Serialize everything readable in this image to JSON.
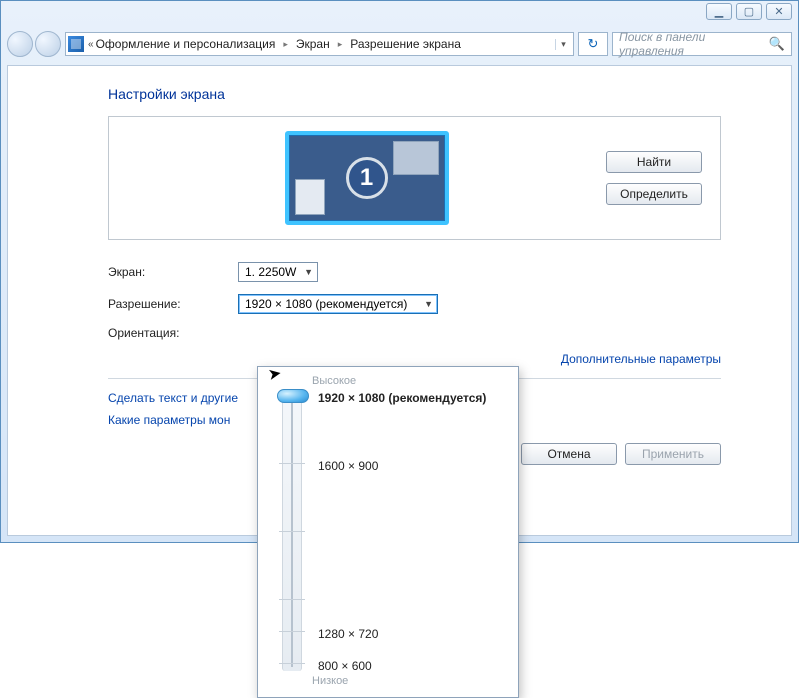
{
  "window": {
    "minimize_symbol": "▁",
    "maximize_symbol": "▢",
    "close_symbol": "✕"
  },
  "address": {
    "chevron_back": "«",
    "crumb1": "Оформление и персонализация",
    "crumb2": "Экран",
    "crumb3": "Разрешение экрана",
    "dropdown_symbol": "▾",
    "refresh_symbol": "↻"
  },
  "search": {
    "placeholder": "Поиск в панели управления",
    "icon": "🔍"
  },
  "page": {
    "title": "Настройки экрана",
    "monitor_number": "1",
    "find_label": "Найти",
    "identify_label": "Определить"
  },
  "form": {
    "screen_label": "Экран:",
    "screen_value": "1. 2250W",
    "resolution_label": "Разрешение:",
    "resolution_value": "1920 × 1080 (рекомендуется)",
    "orientation_label": "Ориентация:"
  },
  "links": {
    "advanced": "Дополнительные параметры",
    "text_size": "Сделать текст и другие",
    "which_params": "Какие параметры мон"
  },
  "footer": {
    "cancel": "Отмена",
    "apply": "Применить"
  },
  "res_popup": {
    "high": "Высокое",
    "low": "Низкое",
    "opt1": "1920 × 1080 (рекомендуется)",
    "opt2": "1600 × 900",
    "opt3": "1280 × 720",
    "opt4": "800 × 600"
  }
}
